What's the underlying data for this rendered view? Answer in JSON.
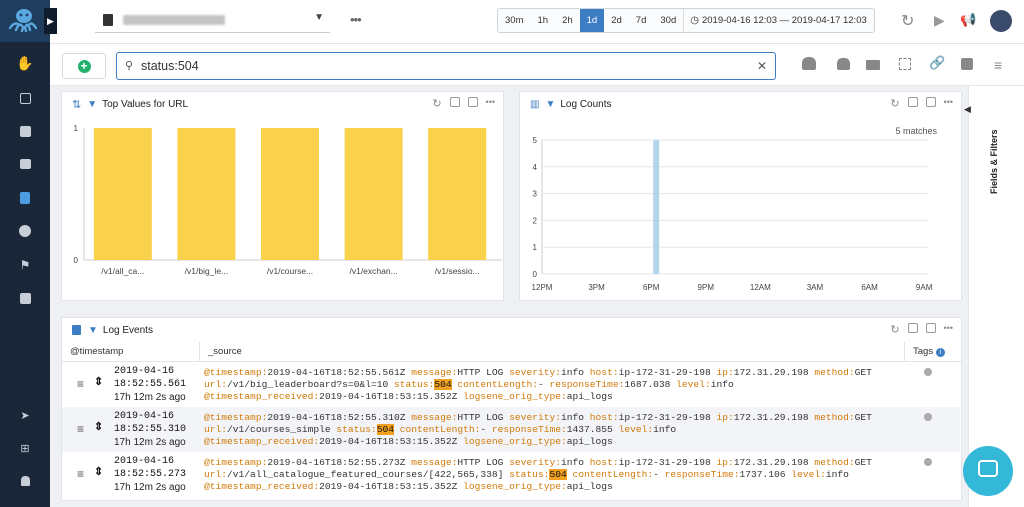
{
  "sidebar": {
    "icons": [
      "octopus-logo",
      "hand-icon",
      "calendar-icon",
      "archive-icon",
      "image-icon",
      "document-icon",
      "palette-icon",
      "flag-icon",
      "puzzle-icon",
      "send-icon",
      "grid-icon",
      "user-icon"
    ]
  },
  "timerange": {
    "options": [
      "30m",
      "1h",
      "2h",
      "1d",
      "2d",
      "7d",
      "30d"
    ],
    "active": "1d",
    "range": "2019-04-16 12:03 — 2019-04-17 12:03"
  },
  "search": {
    "query": "status:504"
  },
  "panels": {
    "top_values": {
      "title": "Top Values for URL"
    },
    "log_counts": {
      "title": "Log Counts",
      "matches": "5 matches"
    }
  },
  "chart_data": [
    {
      "type": "bar",
      "title": "Top Values for URL",
      "categories": [
        "/v1/all_ca...",
        "/v1/big_le...",
        "/v1/course...",
        "/v1/exchan...",
        "/v1/sessio..."
      ],
      "values": [
        1,
        1,
        1,
        1,
        1
      ],
      "ylim": [
        0,
        1
      ],
      "yticks": [
        "0",
        "1"
      ],
      "color": "#f9d14b"
    },
    {
      "type": "bar",
      "title": "Log Counts",
      "x": [
        "12PM",
        "3PM",
        "6PM",
        "9PM",
        "12AM",
        "3AM",
        "6AM",
        "9AM"
      ],
      "yticks": [
        "0",
        "1",
        "2",
        "3",
        "4",
        "5"
      ],
      "spike": {
        "x": "6PM",
        "value": 5
      },
      "ylim": [
        0,
        5
      ],
      "color": "#b5d5ec"
    }
  ],
  "log_events": {
    "title": "Log Events",
    "columns": [
      "@timestamp",
      "_source",
      "Tags"
    ],
    "rows": [
      {
        "date": "2019-04-16",
        "time": "18:52:55.561",
        "ago": "17h 12m 2s ago",
        "l1": [
          [
            "@timestamp:",
            "2019-04-16T18:52:55.561Z"
          ],
          [
            "message:",
            "HTTP LOG"
          ],
          [
            "severity:",
            "info"
          ],
          [
            "host:",
            "ip-172-31-29-198"
          ],
          [
            "ip:",
            "172.31.29.198"
          ],
          [
            "method:",
            "GET"
          ]
        ],
        "l2": [
          [
            "url:",
            "/v1/big_leaderboard?s=0&l=10"
          ],
          [
            "status:",
            "504"
          ],
          [
            "contentLength:",
            "-"
          ],
          [
            "responseTime:",
            "1687.038"
          ],
          [
            "level:",
            "info"
          ]
        ],
        "l3": [
          [
            "@timestamp_received:",
            "2019-04-16T18:53:15.352Z"
          ],
          [
            "logsene_orig_type:",
            "api_logs"
          ]
        ]
      },
      {
        "date": "2019-04-16",
        "time": "18:52:55.310",
        "ago": "17h 12m 2s ago",
        "l1": [
          [
            "@timestamp:",
            "2019-04-16T18:52:55.310Z"
          ],
          [
            "message:",
            "HTTP LOG"
          ],
          [
            "severity:",
            "info"
          ],
          [
            "host:",
            "ip-172-31-29-198"
          ],
          [
            "ip:",
            "172.31.29.198"
          ],
          [
            "method:",
            "GET"
          ]
        ],
        "l2": [
          [
            "url:",
            "/v1/courses_simple"
          ],
          [
            "status:",
            "504"
          ],
          [
            "contentLength:",
            "-"
          ],
          [
            "responseTime:",
            "1437.855"
          ],
          [
            "level:",
            "info"
          ]
        ],
        "l3": [
          [
            "@timestamp_received:",
            "2019-04-16T18:53:15.352Z"
          ],
          [
            "logsene_orig_type:",
            "api_logs"
          ]
        ]
      },
      {
        "date": "2019-04-16",
        "time": "18:52:55.273",
        "ago": "17h 12m 2s ago",
        "l1": [
          [
            "@timestamp:",
            "2019-04-16T18:52:55.273Z"
          ],
          [
            "message:",
            "HTTP LOG"
          ],
          [
            "severity:",
            "info"
          ],
          [
            "host:",
            "ip-172-31-29-198"
          ],
          [
            "ip:",
            "172.31.29.198"
          ],
          [
            "method:",
            "GET"
          ]
        ],
        "l2": [
          [
            "url:",
            "/v1/all_catalogue_featured_courses/[422,565,338]"
          ],
          [
            "status:",
            "504"
          ],
          [
            "contentLength:",
            "-"
          ],
          [
            "responseTime:",
            "1737.106"
          ],
          [
            "level:",
            "info"
          ]
        ],
        "l3": [
          [
            "@timestamp_received:",
            "2019-04-16T18:53:15.352Z"
          ],
          [
            "logsene_orig_type:",
            "api_logs"
          ]
        ]
      }
    ]
  },
  "right_panel": {
    "label": "Fields & Filters"
  }
}
